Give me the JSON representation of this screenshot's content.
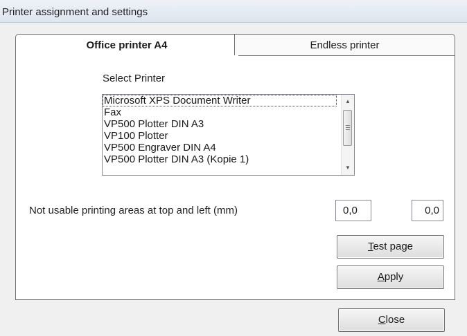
{
  "window": {
    "title": "Printer assignment and settings"
  },
  "tabs": [
    {
      "label": "Office printer A4",
      "active": true
    },
    {
      "label": "Endless printer",
      "active": false
    }
  ],
  "select_printer": {
    "label": "Select Printer",
    "items": [
      "Microsoft XPS Document Writer",
      "Fax",
      "VP500 Plotter DIN A3",
      "VP100 Plotter",
      "VP500 Engraver DIN A4",
      "VP500 Plotter DIN A3 (Kopie 1)"
    ],
    "selected": "Microsoft XPS Document Writer"
  },
  "margins": {
    "label": "Not usable printing areas at top and left (mm)",
    "top": "0,0",
    "left": "0,0"
  },
  "buttons": {
    "test_page": {
      "mnemonic": "T",
      "rest": "est page"
    },
    "apply": {
      "mnemonic": "A",
      "rest": "pply"
    },
    "close": {
      "mnemonic": "C",
      "rest": "lose"
    }
  },
  "icons": {
    "scroll_up": "triangle-up",
    "scroll_down": "triangle-down",
    "scroll_thumb_grip": "three-lines"
  }
}
